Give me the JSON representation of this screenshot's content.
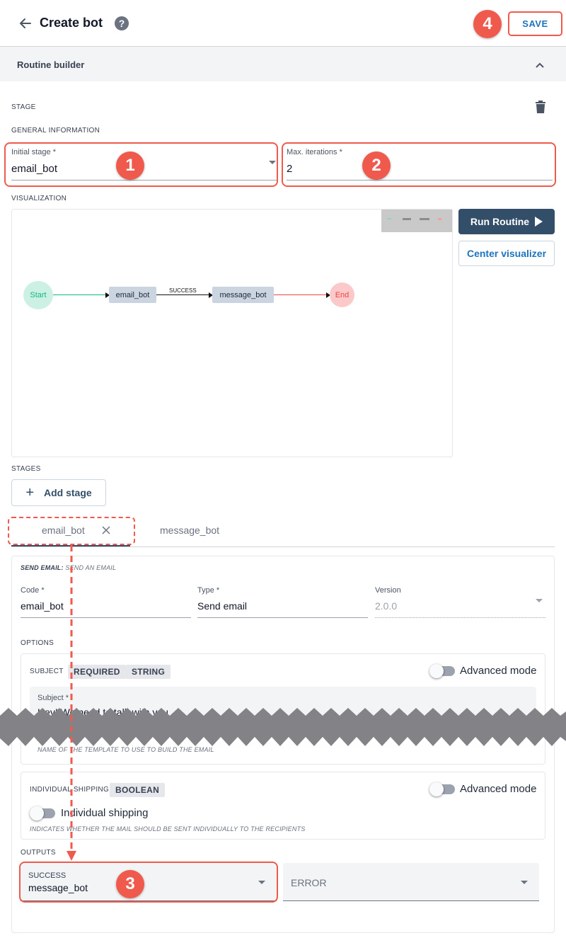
{
  "header": {
    "title": "Create bot",
    "save_label": "SAVE"
  },
  "section": {
    "title": "Routine builder"
  },
  "stage": {
    "overline": "STAGE",
    "general_info": "GENERAL INFORMATION",
    "initial_stage_label": "Initial stage *",
    "initial_stage_value": "email_bot",
    "max_iterations_label": "Max. iterations *",
    "max_iterations_value": "2"
  },
  "visualization": {
    "overline": "VISUALIZATION",
    "run_label": "Run Routine",
    "center_label": "Center visualizer",
    "nodes": {
      "start": "Start",
      "email": "email_bot",
      "message": "message_bot",
      "end": "End"
    },
    "edge_label": "SUCCESS"
  },
  "stages": {
    "overline": "STAGES",
    "add_label": "Add stage",
    "tabs": [
      "email_bot",
      "message_bot"
    ]
  },
  "stage_detail": {
    "header_bold": "SEND EMAIL:",
    "header_rest": " SEND AN EMAIL",
    "code_label": "Code *",
    "code_value": "email_bot",
    "type_label": "Type *",
    "type_value": "Send email",
    "version_label": "Version",
    "version_value": "2.0.0",
    "options_overline": "OPTIONS",
    "subject": {
      "label": "SUBJECT",
      "chips": [
        "REQUIRED",
        "STRING"
      ],
      "advanced": "Advanced mode",
      "field_label": "Subject *",
      "field_value": "Hey! We need to talk with you"
    },
    "template_helper": "NAME OF THE TEMPLATE TO USE TO BUILD THE EMAIL",
    "individual": {
      "label": "INDIVIDUAL SHIPPING",
      "chip": "BOOLEAN",
      "advanced": "Advanced mode",
      "toggle_label": "Individual shipping",
      "helper": "INDICATES WHETHER THE MAIL SHOULD BE SENT INDIVIDUALLY TO THE RECIPIENTS"
    },
    "outputs_overline": "OUTPUTS",
    "success_label": "SUCCESS",
    "success_value": "message_bot",
    "error_label": "ERROR"
  },
  "markers": [
    "1",
    "2",
    "3",
    "4"
  ],
  "colors": {
    "annotation": "#ef5a4d",
    "primary": "#334e68",
    "link": "#1e73be"
  }
}
